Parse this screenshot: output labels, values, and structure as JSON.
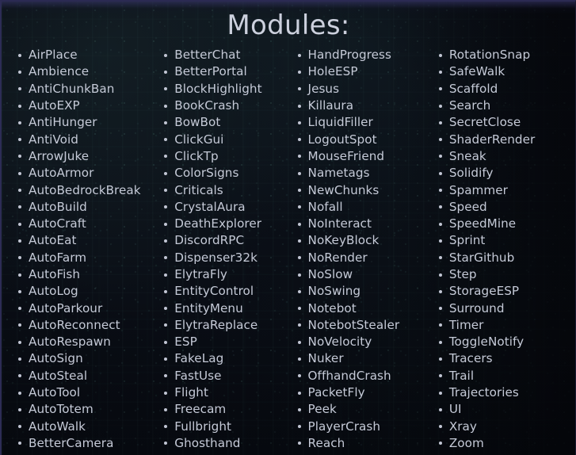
{
  "slide": {
    "title": "Modules:",
    "background_description": "dark navy aerial photo texture",
    "colors": {
      "background": "#0a0e16",
      "text": "#c5cad7",
      "title": "#ccd0dd",
      "bullet": "#c2c6d4",
      "border_top": "#2b2a52"
    }
  },
  "columns": [
    {
      "index": 1,
      "items": [
        "AirPlace",
        "Ambience",
        "AntiChunkBan",
        "AutoEXP",
        "AntiHunger",
        "AntiVoid",
        "ArrowJuke",
        "AutoArmor",
        "AutoBedrockBreak",
        "AutoBuild",
        "AutoCraft",
        "AutoEat",
        "AutoFarm",
        "AutoFish",
        "AutoLog",
        "AutoParkour",
        "AutoReconnect",
        "AutoRespawn",
        "AutoSign",
        "AutoSteal",
        "AutoTool",
        "AutoTotem",
        "AutoWalk",
        "BetterCamera"
      ]
    },
    {
      "index": 2,
      "items": [
        "BetterChat",
        "BetterPortal",
        "BlockHighlight",
        "BookCrash",
        "BowBot",
        "ClickGui",
        "ClickTp",
        "ColorSigns",
        "Criticals",
        "CrystalAura",
        "DeathExplorer",
        "DiscordRPC",
        "Dispenser32k",
        "ElytraFly",
        "EntityControl",
        "EntityMenu",
        "ElytraReplace",
        "ESP",
        "FakeLag",
        "FastUse",
        "Flight",
        "Freecam",
        "Fullbright",
        "Ghosthand"
      ]
    },
    {
      "index": 3,
      "items": [
        "HandProgress",
        "HoleESP",
        "Jesus",
        "Killaura",
        "LiquidFiller",
        "LogoutSpot",
        "MouseFriend",
        "Nametags",
        "NewChunks",
        "Nofall",
        "NoInteract",
        "NoKeyBlock",
        "NoRender",
        "NoSlow",
        "NoSwing",
        "Notebot",
        "NotebotStealer",
        "NoVelocity",
        "Nuker",
        "OffhandCrash",
        "PacketFly",
        "Peek",
        "PlayerCrash",
        "Reach"
      ]
    },
    {
      "index": 4,
      "items": [
        "RotationSnap",
        "SafeWalk",
        "Scaffold",
        "Search",
        "SecretClose",
        "ShaderRender",
        "Sneak",
        "Solidify",
        "Spammer",
        "Speed",
        "SpeedMine",
        "Sprint",
        "StarGithub",
        "Step",
        "StorageESP",
        "Surround",
        "Timer",
        "ToggleNotify",
        "Tracers",
        "Trail",
        "Trajectories",
        "UI",
        "Xray",
        "Zoom"
      ]
    }
  ]
}
